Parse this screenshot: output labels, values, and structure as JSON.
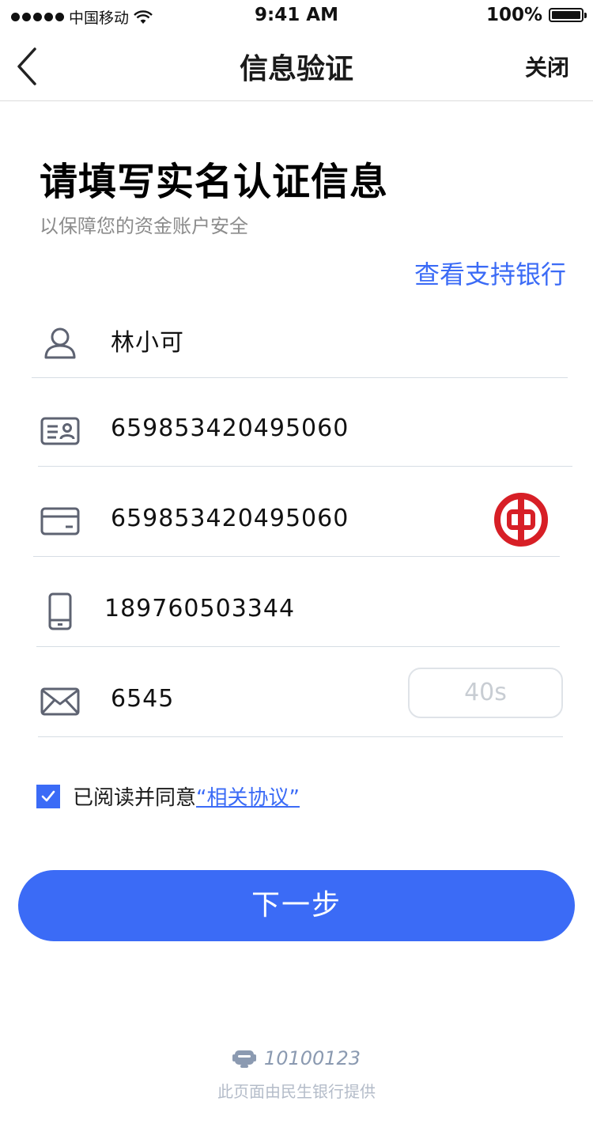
{
  "status_bar": {
    "carrier": "中国移动",
    "time": "9:41 AM",
    "battery": "100%",
    "battery_level": 1.0
  },
  "nav": {
    "title": "信息验证",
    "close_label": "关闭",
    "back_icon": "chevron-left-icon"
  },
  "header": {
    "title": "请填写实名认证信息",
    "subtitle": "以保障您的资金账户安全",
    "supported_banks_link": "查看支持银行"
  },
  "form": {
    "name": {
      "value": "林小可",
      "icon": "user-icon"
    },
    "id_number": {
      "value": "659853420495060",
      "icon": "id-card-icon"
    },
    "card_number": {
      "value": "659853420495060",
      "icon": "bank-card-icon",
      "bank_logo": "bank-of-china-logo"
    },
    "phone": {
      "value": "189760503344",
      "icon": "mobile-phone-icon"
    },
    "sms_code": {
      "value": "6545",
      "icon": "envelope-icon",
      "countdown_label": "40s"
    }
  },
  "agreement": {
    "checked": true,
    "text": "已阅读并同意",
    "link_text": "“相关协议”"
  },
  "next_button": {
    "label": "下一步"
  },
  "footer": {
    "service_phone": "10100123",
    "service_icon": "customer-service-icon",
    "provider_note": "此页面由民生银行提供"
  },
  "colors": {
    "accent": "#3b6bf6",
    "icon_gray": "#5e6372",
    "bank_red": "#d71f26",
    "divider": "#d6dde4"
  }
}
